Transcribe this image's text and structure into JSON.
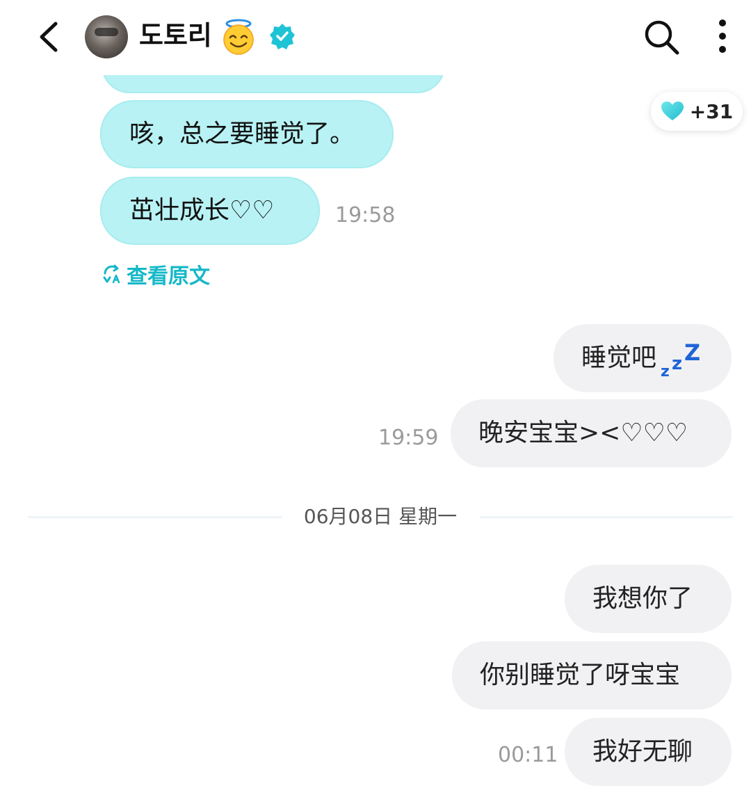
{
  "header": {
    "contact_name": "도토리",
    "halo_emoji": "😇"
  },
  "reaction": {
    "count": "+31",
    "icon": "heart-icon",
    "color": "#3ad0d8"
  },
  "incoming_messages": [
    {
      "text": "咳，总之要睡觉了。"
    },
    {
      "text": "茁壮成长♡♡",
      "time": "19:58"
    }
  ],
  "translate": {
    "label": "查看原文",
    "icon": "translate-icon"
  },
  "outgoing_messages_day1": [
    {
      "text": "睡觉吧"
    },
    {
      "text": "晚安宝宝><♡♡♡",
      "time": "19:59"
    }
  ],
  "zzz": {
    "a": "z",
    "b": "z",
    "c": "Z"
  },
  "date_divider": "06月08日 星期一",
  "outgoing_messages_day2": [
    {
      "text": "我想你了"
    },
    {
      "text": "你别睡觉了呀宝宝"
    },
    {
      "text": "我好无聊",
      "time": "00:11"
    }
  ],
  "colors": {
    "incoming_bubble": "#b8f2f4",
    "outgoing_bubble": "#f1f1f4",
    "accent": "#14b8c8"
  }
}
